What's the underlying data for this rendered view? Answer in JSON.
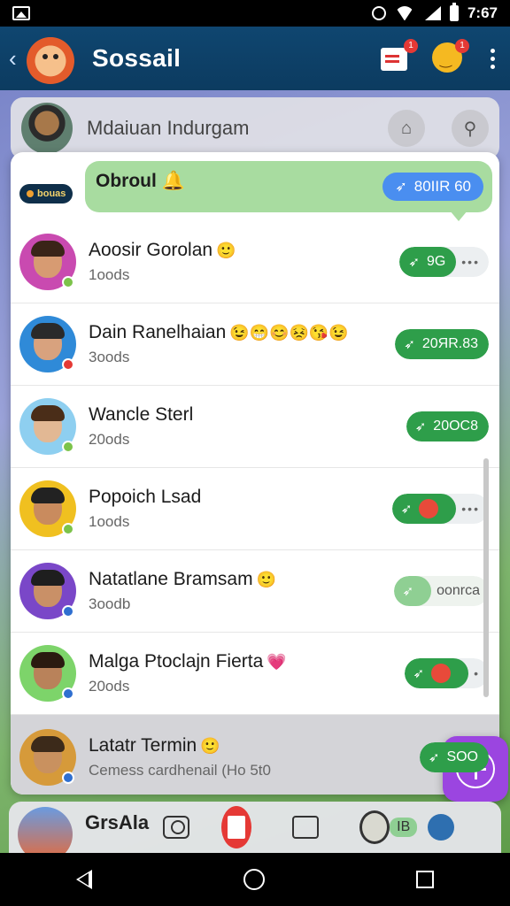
{
  "status_bar": {
    "time": "7:67"
  },
  "app_bar": {
    "title": "Sossail",
    "back": "‹",
    "cart_badge": "1",
    "profile_badge": "1"
  },
  "profile_header": {
    "name": "Mdaiuan Indurgam"
  },
  "bubble": {
    "text": "Obroul",
    "emoji": "🔔",
    "pill_label": "80IIR 60",
    "tag": "bouas"
  },
  "rows": [
    {
      "name": "Aoosir Gorolan",
      "emojis": "🙂",
      "sub": "1oods",
      "action": "9G",
      "ext": "•••",
      "avatar_bg": "#c94ab0",
      "face": "#d79b72",
      "hair": "#3a2418",
      "dot": "#7cc34a"
    },
    {
      "name": "Dain Ranelhaian",
      "emojis": "😉😁😊😣😘😉",
      "sub": "3oods",
      "action": "20ЯR.83",
      "ext": "",
      "avatar_bg": "#2f8ad8",
      "face": "#d8a27e",
      "hair": "#2a2a2a",
      "dot": "#e53935"
    },
    {
      "name": "Wancle Sterl",
      "emojis": "",
      "sub": "20ods",
      "action": "20OC8",
      "ext": "",
      "avatar_bg": "#8ecff0",
      "face": "#e2b894",
      "hair": "#4a2d18",
      "dot": "#7cc34a"
    },
    {
      "name": "Popoich Lsad",
      "emojis": "",
      "sub": "1oods",
      "action": "",
      "ext": "•••",
      "avatar_bg": "#f0c020",
      "face": "#c98b5e",
      "hair": "#222",
      "dot": "#7cc34a"
    },
    {
      "name": "Natatlane Bramsam",
      "emojis": "🙂",
      "sub": "3oodb",
      "action": "",
      "ext": "oonrca",
      "avatar_bg": "#7a47c8",
      "face": "#c99067",
      "hair": "#1e1e1e",
      "dot": "#2f6fd0"
    },
    {
      "name": "Malga Ptoclajn Fierta",
      "emojis": "💗",
      "sub": "20ods",
      "action": "",
      "ext": "•",
      "avatar_bg": "#7dd46a",
      "face": "#b9825a",
      "hair": "#2a1a10",
      "dot": "#2f6fd0"
    },
    {
      "name": "Latatr Termin",
      "emojis": "🙂",
      "sub": "Cemess cardhenail (Ho 5t0",
      "action": "SOO",
      "ext": "",
      "avatar_bg": "#d69a3a",
      "face": "#c9915f",
      "hair": "#3c2a1a",
      "dot": "#2f6fd0"
    }
  ],
  "bottom_bar": {
    "label": "GrsAla",
    "count": "IB"
  },
  "colors": {
    "appbar": "#0f4670",
    "accent_green": "#2e9e4a",
    "bubble_green": "#a8dca0",
    "pill_blue": "#4a8ef0",
    "fab": "#9b45e0"
  }
}
